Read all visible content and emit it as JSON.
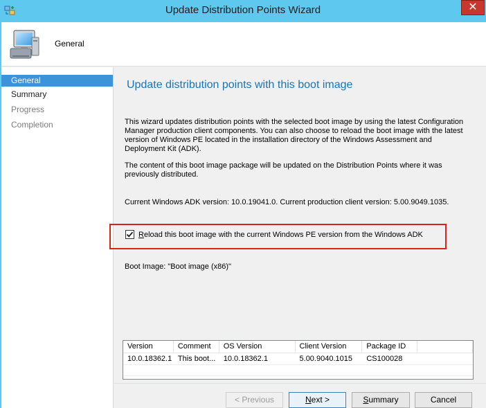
{
  "window": {
    "title": "Update Distribution Points Wizard",
    "close_glyph": "✕"
  },
  "header": {
    "title": "General",
    "icon": "computer-icon"
  },
  "nav": {
    "items": [
      {
        "label": "General",
        "state": "active"
      },
      {
        "label": "Summary",
        "state": "normal"
      },
      {
        "label": "Progress",
        "state": "disabled"
      },
      {
        "label": "Completion",
        "state": "disabled"
      }
    ]
  },
  "main": {
    "heading": "Update distribution points with this boot image",
    "paragraph1": "This wizard updates distribution points with the selected boot image by using the latest Configuration Manager production client components. You can also choose to reload the boot image with the latest version of Windows PE located in the installation directory of the Windows Assessment and Deployment Kit (ADK).",
    "paragraph2": "The content of this boot image package will be updated on the Distribution Points where it was previously distributed.",
    "version_info": "Current Windows ADK version: 10.0.19041.0. Current production client version: 5.00.9049.1035.",
    "reload_checkbox": {
      "checked": true,
      "label_first": "R",
      "label_rest": "eload this boot image with the current Windows PE version from the Windows ADK"
    },
    "boot_image_label": "Boot Image: \"Boot image (x86)\""
  },
  "table": {
    "columns": [
      "Version",
      "Comment",
      "OS Version",
      "Client Version",
      "Package ID",
      ""
    ],
    "rows": [
      [
        "10.0.18362.1",
        "This boot...",
        "10.0.18362.1",
        "5.00.9040.1015",
        "CS100028",
        ""
      ]
    ]
  },
  "buttons": {
    "previous": "< Previous",
    "next": "Next >",
    "summary": "Summary",
    "cancel": "Cancel"
  },
  "colors": {
    "titlebar": "#5fc8ee",
    "nav_active": "#3d93d9",
    "heading": "#1874b8",
    "highlight": "#d9221c",
    "close": "#c7372d"
  }
}
